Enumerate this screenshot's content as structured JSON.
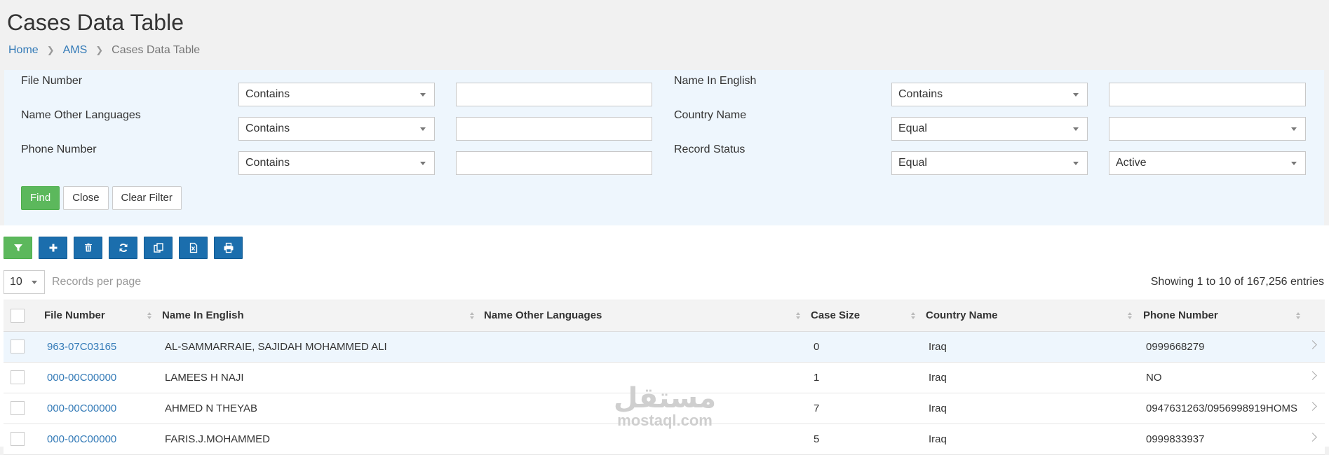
{
  "page": {
    "title": "Cases Data Table",
    "breadcrumb": [
      "Home",
      "AMS",
      "Cases Data Table"
    ]
  },
  "filters": [
    {
      "label": "File Number",
      "operator": "Contains",
      "value": ""
    },
    {
      "label": "Name In English",
      "operator": "Contains",
      "value": ""
    },
    {
      "label": "Name Other Languages",
      "operator": "Contains",
      "value": ""
    },
    {
      "label": "Country Name",
      "operator": "Equal",
      "value": ""
    },
    {
      "label": "Phone Number",
      "operator": "Contains",
      "value": ""
    },
    {
      "label": "Record Status",
      "operator": "Equal",
      "value": "Active"
    }
  ],
  "filter_buttons": {
    "find": "Find",
    "close": "Close",
    "clear": "Clear Filter"
  },
  "toolbar": [
    {
      "icon": "filter-icon",
      "color": "#5cb85c"
    },
    {
      "icon": "plus-icon",
      "color": "#1b6ead"
    },
    {
      "icon": "trash-icon",
      "color": "#1b6ead"
    },
    {
      "icon": "refresh-icon",
      "color": "#1b6ead"
    },
    {
      "icon": "copy-icon",
      "color": "#1b6ead"
    },
    {
      "icon": "excel-icon",
      "color": "#1b6ead"
    },
    {
      "icon": "print-icon",
      "color": "#1b6ead"
    }
  ],
  "length": {
    "value": "10",
    "label": "Records per page"
  },
  "info": "Showing 1 to 10 of 167,256 entries",
  "table": {
    "columns": [
      "File Number",
      "Name In English",
      "Name Other Languages",
      "Case Size",
      "Country Name",
      "Phone Number"
    ],
    "rows": [
      {
        "file_number": "963-07C03165",
        "name_en": "AL-SAMMARRAIE, SAJIDAH MOHAMMED ALI",
        "name_other": "",
        "case_size": "0",
        "country": "Iraq",
        "phone": "0999668279"
      },
      {
        "file_number": "000-00C00000",
        "name_en": "LAMEES H NAJI",
        "name_other": "",
        "case_size": "1",
        "country": "Iraq",
        "phone": "NO"
      },
      {
        "file_number": "000-00C00000",
        "name_en": "AHMED N THEYAB",
        "name_other": "",
        "case_size": "7",
        "country": "Iraq",
        "phone": "0947631263/0956998919HOMS"
      },
      {
        "file_number": "000-00C00000",
        "name_en": "FARIS.J.MOHAMMED",
        "name_other": "",
        "case_size": "5",
        "country": "Iraq",
        "phone": "0999833937"
      }
    ]
  },
  "watermark": {
    "arabic": "مستقل",
    "latin": "mostaql.com"
  }
}
